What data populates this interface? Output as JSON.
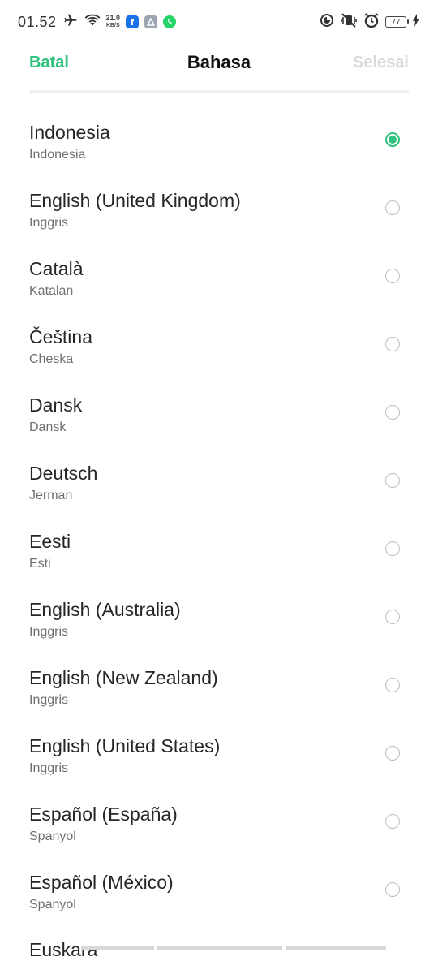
{
  "status_bar": {
    "time": "01.52",
    "speed_value": "21.0",
    "speed_unit": "KB/S",
    "battery": "77",
    "icons": [
      "airplane-icon",
      "wifi-icon",
      "app-badge-blue",
      "app-badge-gray",
      "whatsapp-icon",
      "data-saver-icon",
      "vibrate-off-icon",
      "alarm-icon",
      "battery-icon",
      "charging-icon"
    ]
  },
  "header": {
    "cancel_label": "Batal",
    "title": "Bahasa",
    "done_label": "Selesai"
  },
  "languages": [
    {
      "name": "Indonesia",
      "native": "Indonesia",
      "selected": true
    },
    {
      "name": "English (United Kingdom)",
      "native": "Inggris",
      "selected": false
    },
    {
      "name": "Català",
      "native": "Katalan",
      "selected": false
    },
    {
      "name": "Čeština",
      "native": "Cheska",
      "selected": false
    },
    {
      "name": "Dansk",
      "native": "Dansk",
      "selected": false
    },
    {
      "name": "Deutsch",
      "native": "Jerman",
      "selected": false
    },
    {
      "name": "Eesti",
      "native": "Esti",
      "selected": false
    },
    {
      "name": "English (Australia)",
      "native": "Inggris",
      "selected": false
    },
    {
      "name": "English (New Zealand)",
      "native": "Inggris",
      "selected": false
    },
    {
      "name": "English (United States)",
      "native": "Inggris",
      "selected": false
    },
    {
      "name": "Español (España)",
      "native": "Spanyol",
      "selected": false
    },
    {
      "name": "Español (México)",
      "native": "Spanyol",
      "selected": false
    }
  ],
  "partial_item": "Euskara",
  "colors": {
    "accent": "#2ec27e",
    "disabled": "#d9d9d9"
  }
}
